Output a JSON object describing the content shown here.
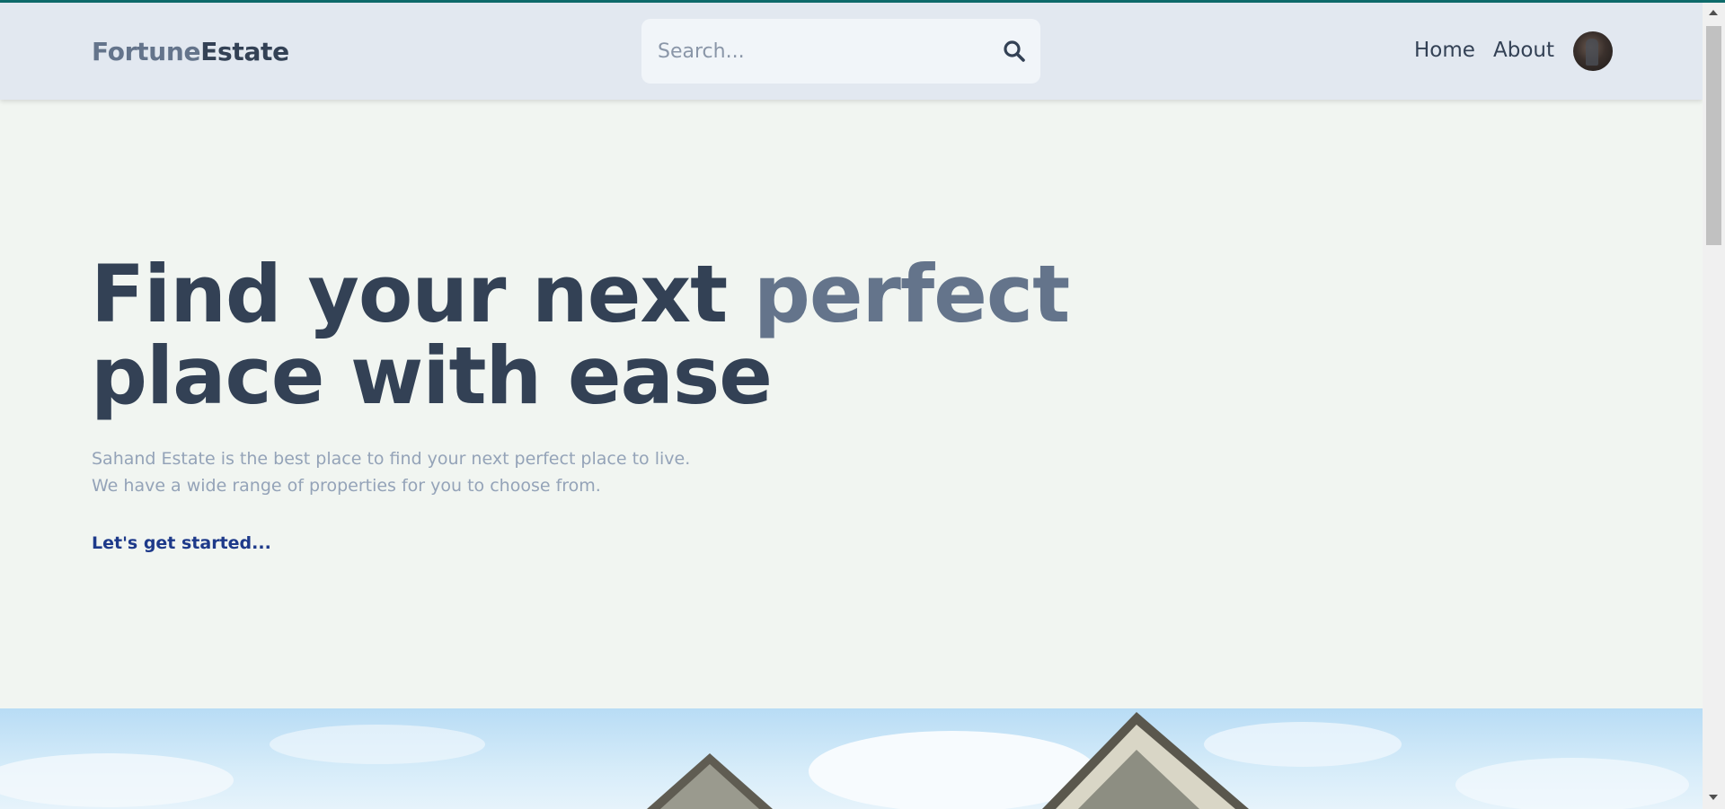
{
  "header": {
    "logo_part1": "Fortune",
    "logo_part2": "Estate",
    "search": {
      "placeholder": "Search...",
      "icon": "search-icon"
    },
    "nav": {
      "home": "Home",
      "about": "About"
    },
    "avatar_icon": "user-avatar"
  },
  "hero": {
    "title_part1": "Find your next ",
    "title_accent": "perfect",
    "title_part2": "place with ease",
    "description_line1": "Sahand Estate is the best place to find your next perfect place to live.",
    "description_line2": "We have a wide range of properties for you to choose from.",
    "cta_label": "Let's get started..."
  },
  "colors": {
    "header_bg": "#e2e8f0",
    "page_bg": "#f1f5f1",
    "title": "#334155",
    "accent": "#64748b",
    "description": "#94a3b8",
    "cta": "#1e3a8a",
    "top_accent": "#0e6b6b"
  }
}
